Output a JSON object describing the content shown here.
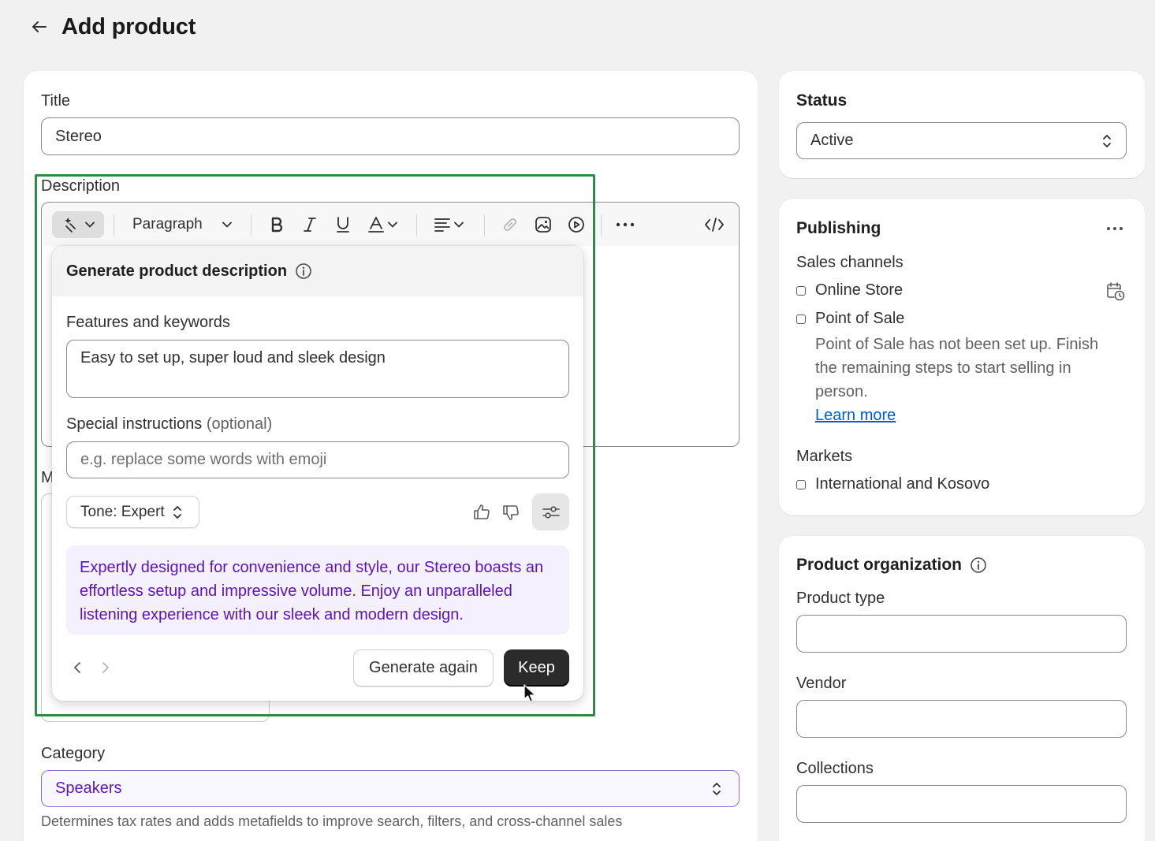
{
  "header": {
    "title": "Add product"
  },
  "main": {
    "title_label": "Title",
    "title_value": "Stereo",
    "description_label": "Description",
    "toolbar": {
      "paragraph_label": "Paragraph"
    },
    "partial_label": "M",
    "category_label": "Category",
    "category_value": "Speakers",
    "category_help": "Determines tax rates and adds metafields to improve search, filters, and cross-channel sales"
  },
  "generator": {
    "title": "Generate product description",
    "features_label": "Features and keywords",
    "features_value": "Easy to set up, super loud and sleek design",
    "instructions_label": "Special instructions",
    "instructions_optional": "(optional)",
    "instructions_placeholder": "e.g. replace some words with emoji",
    "tone_label": "Tone: Expert",
    "result_text": "Expertly designed for convenience and style, our Stereo boasts an effortless setup and impressive volume. Enjoy an unparalleled listening experience with our sleek and modern design.",
    "generate_again_label": "Generate again",
    "keep_label": "Keep"
  },
  "status": {
    "title": "Status",
    "value": "Active"
  },
  "publishing": {
    "title": "Publishing",
    "sales_channels_label": "Sales channels",
    "channels": [
      {
        "label": "Online Store"
      },
      {
        "label": "Point of Sale"
      }
    ],
    "pos_note": "Point of Sale has not been set up. Finish the remaining steps to start selling in person.",
    "learn_more": "Learn more",
    "markets_label": "Markets",
    "markets": [
      {
        "label": "International and Kosovo"
      }
    ]
  },
  "organization": {
    "title": "Product organization",
    "product_type_label": "Product type",
    "vendor_label": "Vendor",
    "collections_label": "Collections"
  },
  "colors": {
    "accent_purple": "#5b14b8",
    "result_bg": "#f4f0fe",
    "primary_button": "#2b2b2b",
    "link": "#005bd3",
    "highlight_frame": "#2e8b47"
  }
}
